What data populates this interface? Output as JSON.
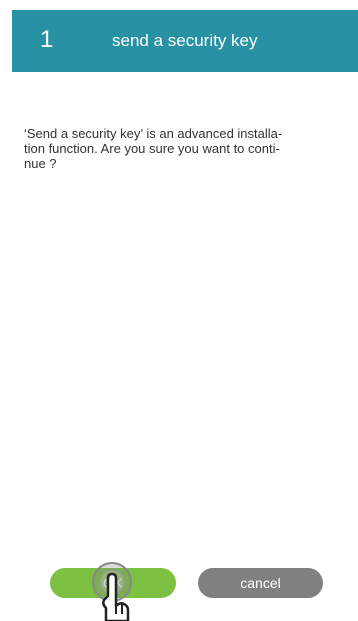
{
  "header": {
    "step_number": "1",
    "title": "send a security key",
    "background_color": "#2891a3"
  },
  "dialog": {
    "message": "‘Send a security key’ is an advanced installa-\ntion function. Are you sure you want to conti-\nnue ?"
  },
  "buttons": {
    "ok_label": "OK",
    "cancel_label": "cancel",
    "ok_color": "#7dc143",
    "cancel_color": "#808080"
  },
  "cursor": {
    "icon": "hand-pointer-icon"
  }
}
